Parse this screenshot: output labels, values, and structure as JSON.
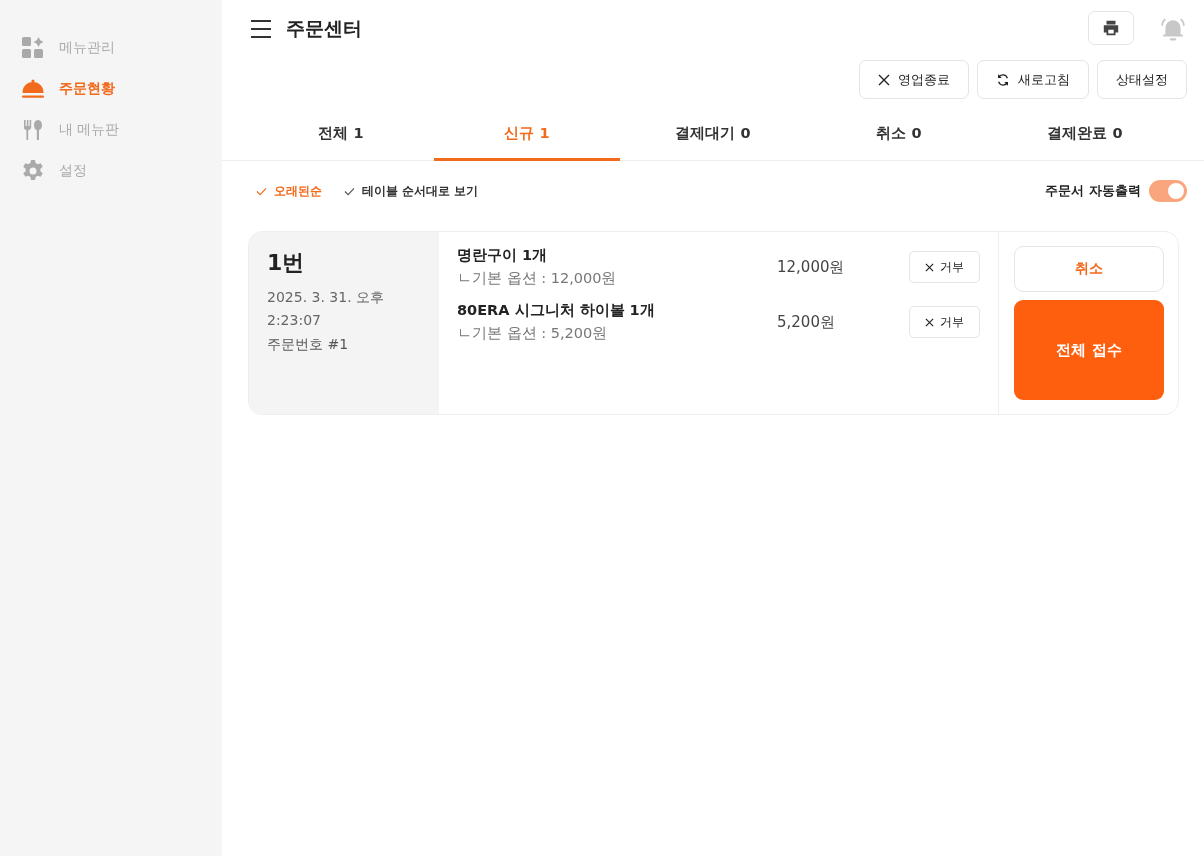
{
  "sidebar": {
    "items": [
      {
        "label": "메뉴관리",
        "selected": false
      },
      {
        "label": "주문현황",
        "selected": true
      },
      {
        "label": "내 메뉴판",
        "selected": false
      },
      {
        "label": "설정",
        "selected": false
      }
    ]
  },
  "header": {
    "title": "주문센터"
  },
  "actions": [
    {
      "label": "영업종료"
    },
    {
      "label": "새로고침"
    },
    {
      "label": "상태설정"
    }
  ],
  "tabs": [
    {
      "label": "전체 1",
      "selected": false
    },
    {
      "label": "신규 1",
      "selected": true
    },
    {
      "label": "결제대기 0",
      "selected": false
    },
    {
      "label": "취소 0",
      "selected": false
    },
    {
      "label": "결제완료 0",
      "selected": false
    }
  ],
  "sort_options": [
    {
      "label": "오래된순",
      "selected": true
    },
    {
      "label": "테이블 순서대로 보기",
      "selected": false
    }
  ],
  "auto_print": {
    "label": "주문서 자동출력",
    "on": true
  },
  "orders": [
    {
      "table": "1번",
      "time": "2025. 3. 31. 오후 2:23:07",
      "order_no": "주문번호 #1",
      "items": [
        {
          "name": "명란구이 1개",
          "option": "ㄴ기본 옵션 : 12,000원",
          "price": "12,000원",
          "reject": "거부"
        },
        {
          "name": "80ERA 시그니처 하이볼 1개",
          "option": "ㄴ기본 옵션 : 5,200원",
          "price": "5,200원",
          "reject": "거부"
        }
      ],
      "cancel": "취소",
      "accept": "전체 접수"
    }
  ]
}
